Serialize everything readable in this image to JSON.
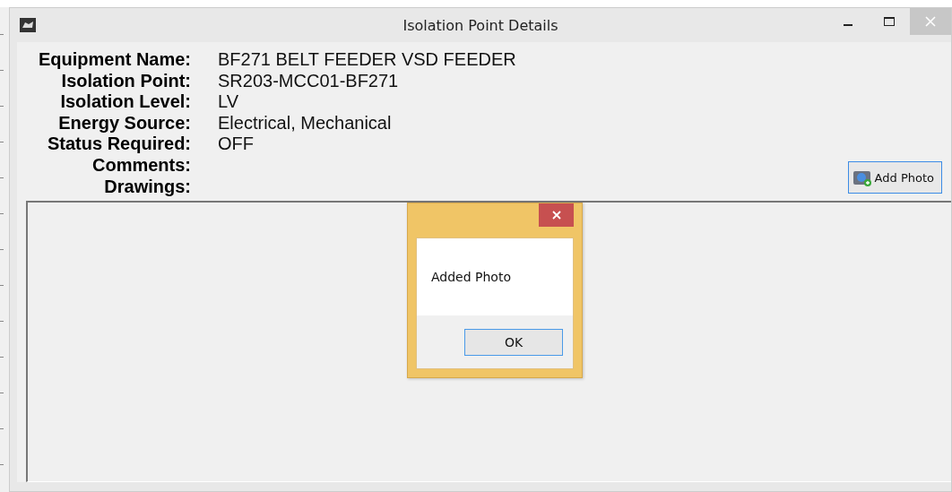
{
  "window": {
    "title": "Isolation Point Details"
  },
  "details": [
    {
      "label": "Equipment Name:",
      "value": "BF271 BELT FEEDER VSD FEEDER"
    },
    {
      "label": "Isolation Point:",
      "value": "SR203-MCC01-BF271"
    },
    {
      "label": "Isolation Level:",
      "value": "LV"
    },
    {
      "label": "Energy Source:",
      "value": "Electrical, Mechanical"
    },
    {
      "label": "Status Required:",
      "value": "OFF"
    },
    {
      "label": "Comments:"
    },
    {
      "label": "Drawings:"
    }
  ],
  "add_photo_button": {
    "label": "Add Photo"
  },
  "dialog": {
    "message": "Added Photo",
    "ok_button": "OK"
  }
}
